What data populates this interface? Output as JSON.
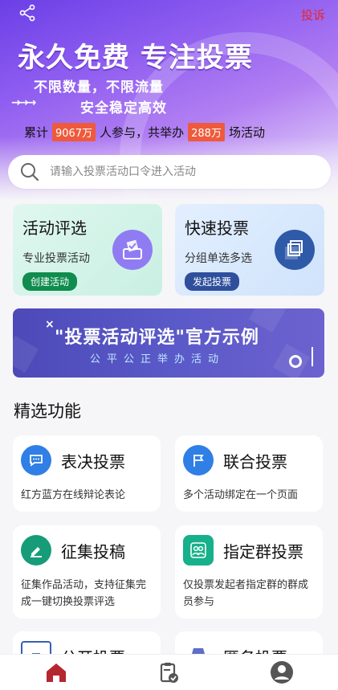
{
  "header": {
    "share_icon": "share-icon",
    "complain_label": "投诉",
    "title": "永久免费 专注投票",
    "subtitle1": "不限数量，不限流量",
    "arrows": "→→→",
    "subtitle2": "安全稳定高效",
    "stats": {
      "prefix": "累计",
      "participants": "9067万",
      "middle": "人参与，共举办",
      "activities": "288万",
      "suffix": "场活动"
    }
  },
  "search": {
    "placeholder": "请输入投票活动口令进入活动",
    "icon": "search-icon"
  },
  "cards": [
    {
      "title": "活动评选",
      "desc": "专业投票活动",
      "button": "创建活动",
      "icon": "ballot-box-icon",
      "color": "#0f8c4e"
    },
    {
      "title": "快速投票",
      "desc": "分组单选多选",
      "button": "发起投票",
      "icon": "stacked-pages-icon",
      "color": "#2f4f9c"
    }
  ],
  "banner": {
    "title": "\"投票活动评选\"官方示例",
    "subtitle": "公平公正举办活动"
  },
  "section": {
    "title": "精选功能"
  },
  "features": [
    {
      "name": "表决投票",
      "desc": "红方蓝方在线辩论表论",
      "icon": "chat-bubble-icon",
      "color": "#2f7fe6"
    },
    {
      "name": "联合投票",
      "desc": "多个活动绑定在一个页面",
      "icon": "flag-icon",
      "color": "#2f7fe6"
    },
    {
      "name": "征集投稿",
      "desc": "征集作品活动，支持征集完成一键切换投票评选",
      "icon": "pen-ribbon-icon",
      "color": "#169c78"
    },
    {
      "name": "指定群投票",
      "desc": "仅投票发起者指定群的群成员参与",
      "icon": "group-people-icon",
      "color": "#16b08a"
    },
    {
      "name": "公开投票",
      "desc": "",
      "icon": "document-icon",
      "color": "#3a5fb0"
    },
    {
      "name": "匿名投票",
      "desc": "",
      "icon": "spy-icon",
      "color": "#5d6fc6"
    }
  ],
  "nav": [
    {
      "label": "home",
      "icon": "home-icon",
      "color": "#b5262f"
    },
    {
      "label": "my-votes",
      "icon": "clipboard-check-icon",
      "color": "#555555"
    },
    {
      "label": "profile",
      "icon": "user-icon",
      "color": "#555555"
    }
  ]
}
